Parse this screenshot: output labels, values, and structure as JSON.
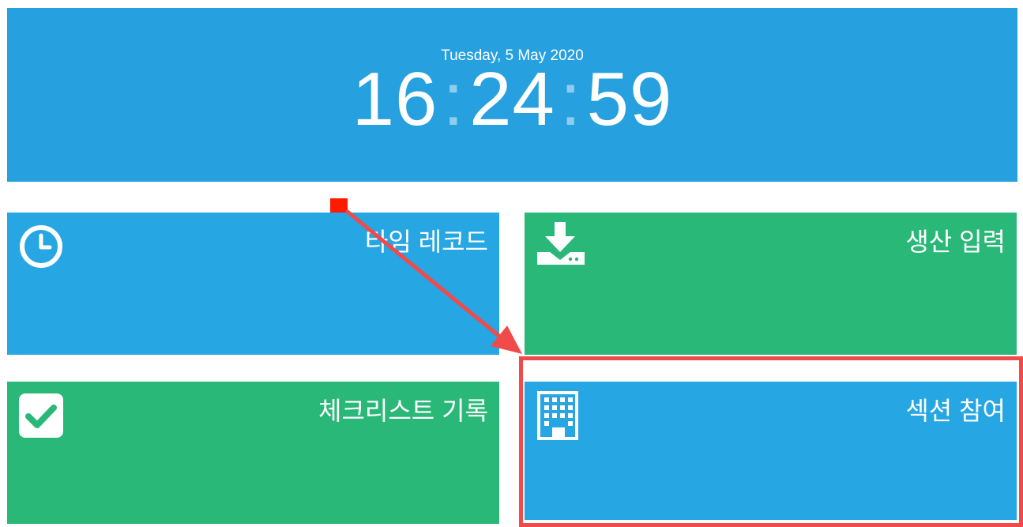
{
  "clock": {
    "date": "Tuesday, 5 May 2020",
    "hours": "16",
    "minutes": "24",
    "seconds": "59",
    "separator": ":"
  },
  "tiles": [
    {
      "label": "타임 레코드",
      "icon": "clock-icon",
      "color": "#26a6e2"
    },
    {
      "label": "생산 입력",
      "icon": "download-icon",
      "color": "#2ab878"
    },
    {
      "label": "체크리스트 기록",
      "icon": "checkbox-icon",
      "color": "#2ab878"
    },
    {
      "label": "섹션 참여",
      "icon": "building-icon",
      "color": "#26a6e2"
    }
  ],
  "annotation": {
    "color": "#f04a4a",
    "marker_color": "#ff1a00"
  }
}
